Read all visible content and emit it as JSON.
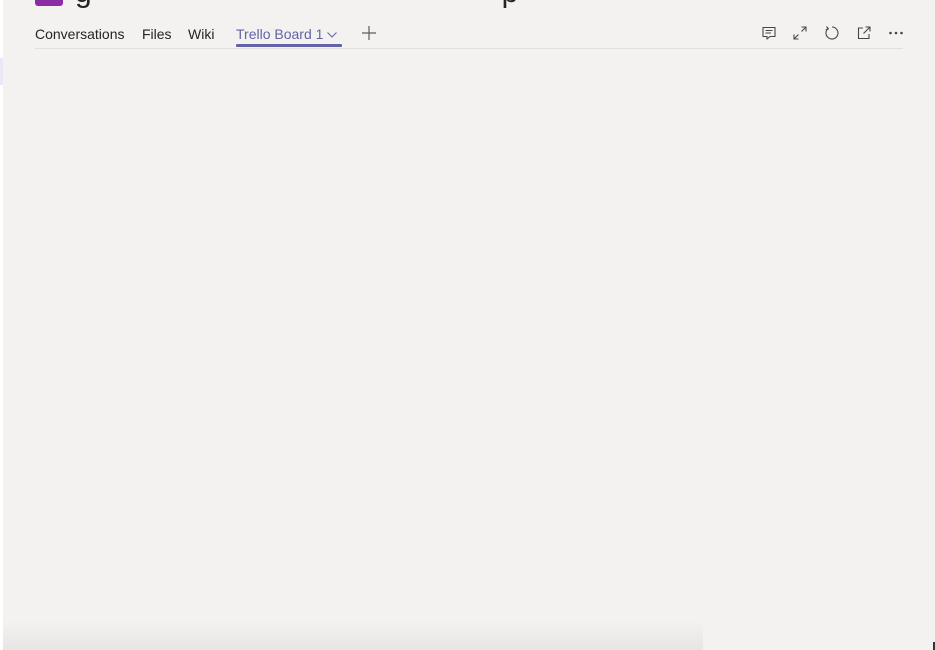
{
  "tabs": {
    "conversations": "Conversations",
    "files": "Files",
    "wiki": "Wiki",
    "trello": "Trello Board 1"
  },
  "icons": {
    "add_tab": "plus-icon",
    "conversation": "conversation-icon",
    "expand": "expand-icon",
    "reload": "reload-icon",
    "popout": "popout-icon",
    "more": "more-options-icon"
  },
  "colors": {
    "accent": "#6264a7",
    "team_avatar": "#8a2da5",
    "background": "#f3f2f1"
  }
}
